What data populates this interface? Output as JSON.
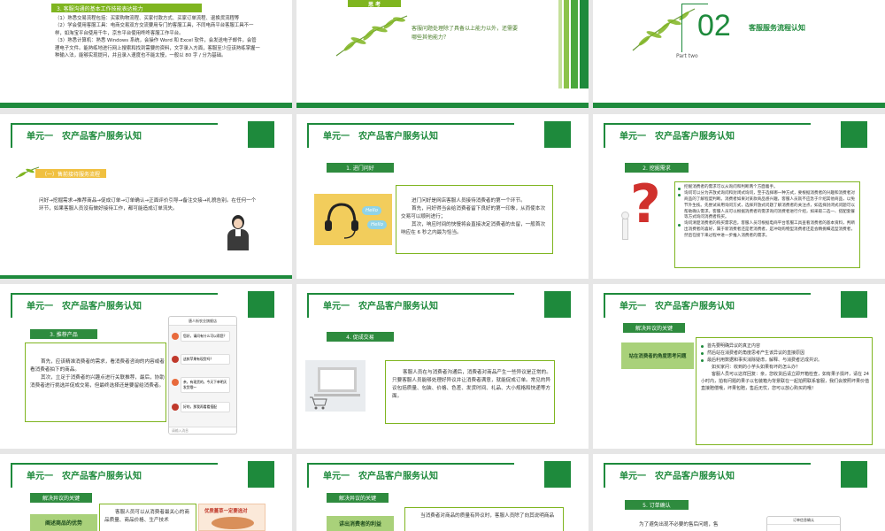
{
  "slide1": {
    "tag": "3. 客服沟通的基本工作技能表达能力",
    "lines": [
      "（1）熟悉交易流程包括：买家购物流程、买家付款方式、买家订单流程、退换货流程等",
      "（2）学会使用客服工具：电商交易双方交流要用专门的客服工具，不同电商平台客服工具不一样，如淘宝平台使用千牛，京东平台使用咚咚客服工作平台。",
      "（3）熟悉计算机：熟悉 Windows 系统，会操作 Word 和 Excel 软件，会发送电子邮件，会管理电子文件。能熟练地进行网上搜索和找到需要的资料，文字录入方面，客服至少应该熟练掌握一种输入法，能够实现提问，并且录入速度也不能太慢，一般以 80 字 / 分为基础。"
    ]
  },
  "slide2": {
    "title": "思 考",
    "question": "客服问题处理除了具备以上能力以外，还需要哪些其他能力？"
  },
  "slide3": {
    "number": "02",
    "title": "客服服务流程认知",
    "part": "Part two"
  },
  "unit_title": "单元一　农产品客户服务认知",
  "slide4": {
    "tag": "（一）售前接待服务流程",
    "text": "问好→挖掘需求→推荐商品→促成订单→订单确认→正面评价引导→备注交接→礼貌告别。在任何一个环节，如果客服人员没有做好接待工作，都可能造成订单流失。"
  },
  "slide5": {
    "tag": "1. 进门问好",
    "bubble1": "Hello",
    "bubble2": "Hello",
    "p1": "进门问好是网店客服人员接待消费者的第一个环节。",
    "p2": "首先，问好得当会给消费者留下良好的第一印象，从而使本次交易可以顺利进行；",
    "p3": "其次，响应时间的快慢将会直接决定消费者的去留，一般首次响应在 6 秒之内最为恰当。"
  },
  "slide6": {
    "tag": "2. 挖掘需求",
    "items": [
      "挖掘消费者的需求可以从询问和判断两个方面着手。",
      "询问可以分为开放式询问和封闭式询问，至于选择哪一种方式，要根据消费者的兴趣和消费者对商品的了解程度判断。消费者如果对某款商品感兴趣，客服人员就不应急于介绍其他商品，以免节外生枝。先尝试采用询问方式，选择开放式问题了解消费者的关注点，如选择封闭式问题可以帮助确认需求。客服人员可以根据消费者的需求询问消费者进行介绍，如采取二选一、搭配套餐等方式询问消费者购买。",
      "询问清楚消费者的购买需求后，客服人员可根据电商平台客服工具查看消费者的基本资料，判断出消费者的喜好，属于新消费者还是老消费者。是冲动购物型消费者还是会精挑细选型消费者，然后在接下来过程中进一步推入消费者的需求。"
    ]
  },
  "slide7": {
    "tag": "3. 推荐产品",
    "p1": "首先，应该精准消费者的需求，看消费者咨询的内容或者看消费者拍下的商品。",
    "p2": "其次，立足于消费者的兴趣点进行关联推荐，最后，协助消费者进行挑选并促成交易，但最终选择还是要留给消费者。",
    "chat_header": "唐人街农业旗舰店",
    "chat_msgs": [
      "您好，请问有什么可以帮您？",
      "这款苹果有现货吗？",
      "亲，有现货的，今天下单明天发货哦～",
      "好的，那我再看看搭配"
    ],
    "chat_input": "请输入消息"
  },
  "slide8": {
    "tag": "4. 促成交易",
    "text": "客服人员在与消费者沟通后，消费者对商品产生一些异议是正常的。只要客服人员能够处理好异议并让消费者满意，就能促成订单。常见的异议包括质量、包装、价格、色差、发货时间、礼品、大小规格和快递等方面。"
  },
  "slide9": {
    "tag": "解决异议的关键",
    "side_label": "站在消费者的角度思考问题",
    "items": [
      "首先要明确异议的真正内容",
      "然后站在消费者的角度思考产生该异议的直接原因",
      "最后利用数据和事实消除疑虑，解释、与消费者达成共识。"
    ],
    "q": "如买家问：收到的小芋头如果有坏的怎么办？",
    "a": "客服人员可以这样回复：亲，您收货后请立即开箱检查，如有果子损坏，请在 24 小时内，拍有问题的果子以包装箱为背景联在一起拍照联系客服，我们会按照坏果价值直接赔偿哦，坏果包赔，售后无忧，您可以放心购买的哦！"
  },
  "slide10": {
    "tag": "解决异议的关键",
    "side_label": "阐述商品的优势",
    "text": "客服人员可以从消费者最关心的商品质量、商品价格、生产技术",
    "img_label": "优质蔓草一定要选对"
  },
  "slide11": {
    "tag": "解决异议的关键",
    "side_label": "讲出消费者的利益",
    "text": "当消费者对商品的质量有异议时，客服人员除了向其说明商品"
  },
  "slide12": {
    "tag": "5. 订单确认",
    "text": "为了避免出现不必要的售后问题，售",
    "mini_label": "订单信息确认"
  },
  "colors": {
    "brand_green": "#1e8a3c",
    "lime": "#7fb520",
    "accent_red": "#d0312d"
  }
}
